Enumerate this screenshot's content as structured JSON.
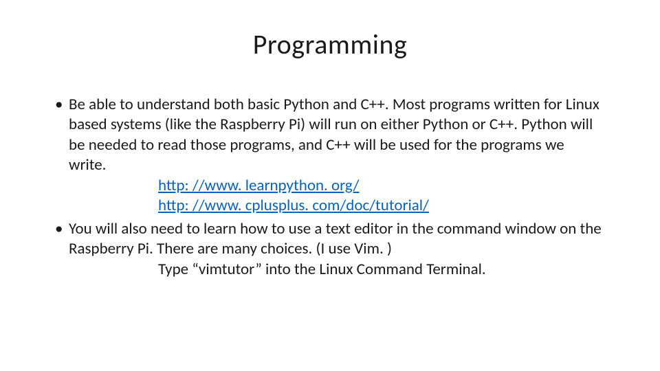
{
  "slide": {
    "title": "Programming",
    "bullet1_text": "Be able to understand both basic Python and C++. Most programs written for Linux based systems (like the Raspberry Pi) will run on either Python or C++. Python will be needed to read those programs, and C++ will be used for the programs we write.",
    "link1": "http: //www. learnpython. org/",
    "link2": "http: //www. cplusplus. com/doc/tutorial/",
    "bullet2_text": "You will also need to learn how to use a text editor in the command window on the Raspberry Pi. There are many choices. (I use Vim. )",
    "bullet2_sub": "Type “vimtutor” into the Linux Command Terminal."
  }
}
